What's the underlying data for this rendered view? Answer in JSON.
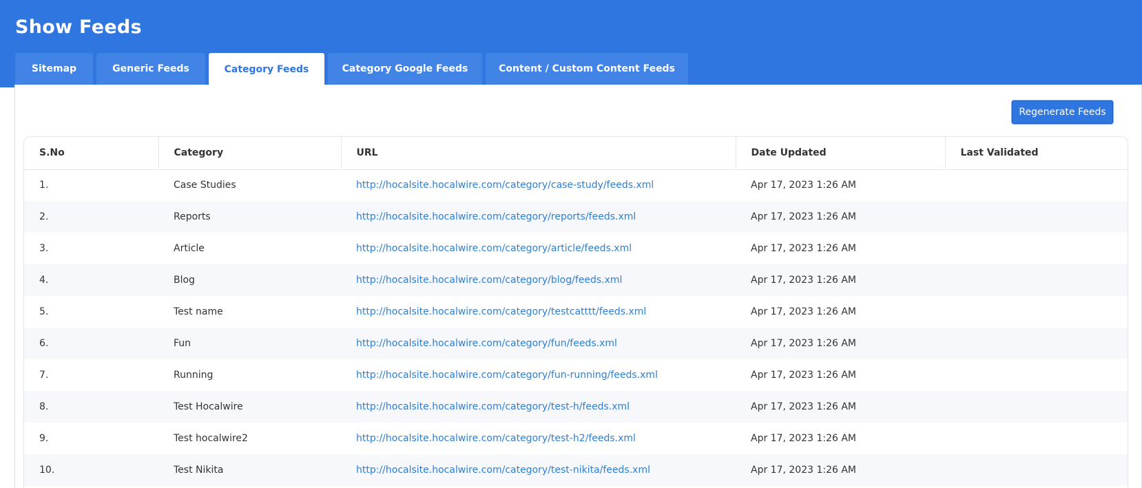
{
  "header": {
    "title": "Show Feeds"
  },
  "tabs": [
    {
      "label": "Sitemap"
    },
    {
      "label": "Generic Feeds"
    },
    {
      "label": "Category Feeds"
    },
    {
      "label": "Category Google Feeds"
    },
    {
      "label": "Content / Custom Content Feeds"
    }
  ],
  "active_tab": "Category Feeds",
  "toolbar": {
    "regenerate_label": "Regenerate Feeds"
  },
  "table": {
    "columns": [
      "S.No",
      "Category",
      "URL",
      "Date Updated",
      "Last Validated"
    ],
    "rows": [
      {
        "sno": "1.",
        "category": "Case Studies",
        "url": "http://hocalsite.hocalwire.com/category/case-study/feeds.xml",
        "date_updated": "Apr 17, 2023 1:26 AM",
        "last_validated": ""
      },
      {
        "sno": "2.",
        "category": "Reports",
        "url": "http://hocalsite.hocalwire.com/category/reports/feeds.xml",
        "date_updated": "Apr 17, 2023 1:26 AM",
        "last_validated": ""
      },
      {
        "sno": "3.",
        "category": "Article",
        "url": "http://hocalsite.hocalwire.com/category/article/feeds.xml",
        "date_updated": "Apr 17, 2023 1:26 AM",
        "last_validated": ""
      },
      {
        "sno": "4.",
        "category": "Blog",
        "url": "http://hocalsite.hocalwire.com/category/blog/feeds.xml",
        "date_updated": "Apr 17, 2023 1:26 AM",
        "last_validated": ""
      },
      {
        "sno": "5.",
        "category": "Test name",
        "url": "http://hocalsite.hocalwire.com/category/testcatttt/feeds.xml",
        "date_updated": "Apr 17, 2023 1:26 AM",
        "last_validated": ""
      },
      {
        "sno": "6.",
        "category": "Fun",
        "url": "http://hocalsite.hocalwire.com/category/fun/feeds.xml",
        "date_updated": "Apr 17, 2023 1:26 AM",
        "last_validated": ""
      },
      {
        "sno": "7.",
        "category": "Running",
        "url": "http://hocalsite.hocalwire.com/category/fun-running/feeds.xml",
        "date_updated": "Apr 17, 2023 1:26 AM",
        "last_validated": ""
      },
      {
        "sno": "8.",
        "category": "Test Hocalwire",
        "url": "http://hocalsite.hocalwire.com/category/test-h/feeds.xml",
        "date_updated": "Apr 17, 2023 1:26 AM",
        "last_validated": ""
      },
      {
        "sno": "9.",
        "category": "Test hocalwire2",
        "url": "http://hocalsite.hocalwire.com/category/test-h2/feeds.xml",
        "date_updated": "Apr 17, 2023 1:26 AM",
        "last_validated": ""
      },
      {
        "sno": "10.",
        "category": "Test Nikita",
        "url": "http://hocalsite.hocalwire.com/category/test-nikita/feeds.xml",
        "date_updated": "Apr 17, 2023 1:26 AM",
        "last_validated": ""
      }
    ]
  },
  "colors": {
    "header_bg": "#2f76e0",
    "tab_bg": "#4283e6",
    "link": "#2d7fd3",
    "row_alt": "#f6f8fc"
  }
}
